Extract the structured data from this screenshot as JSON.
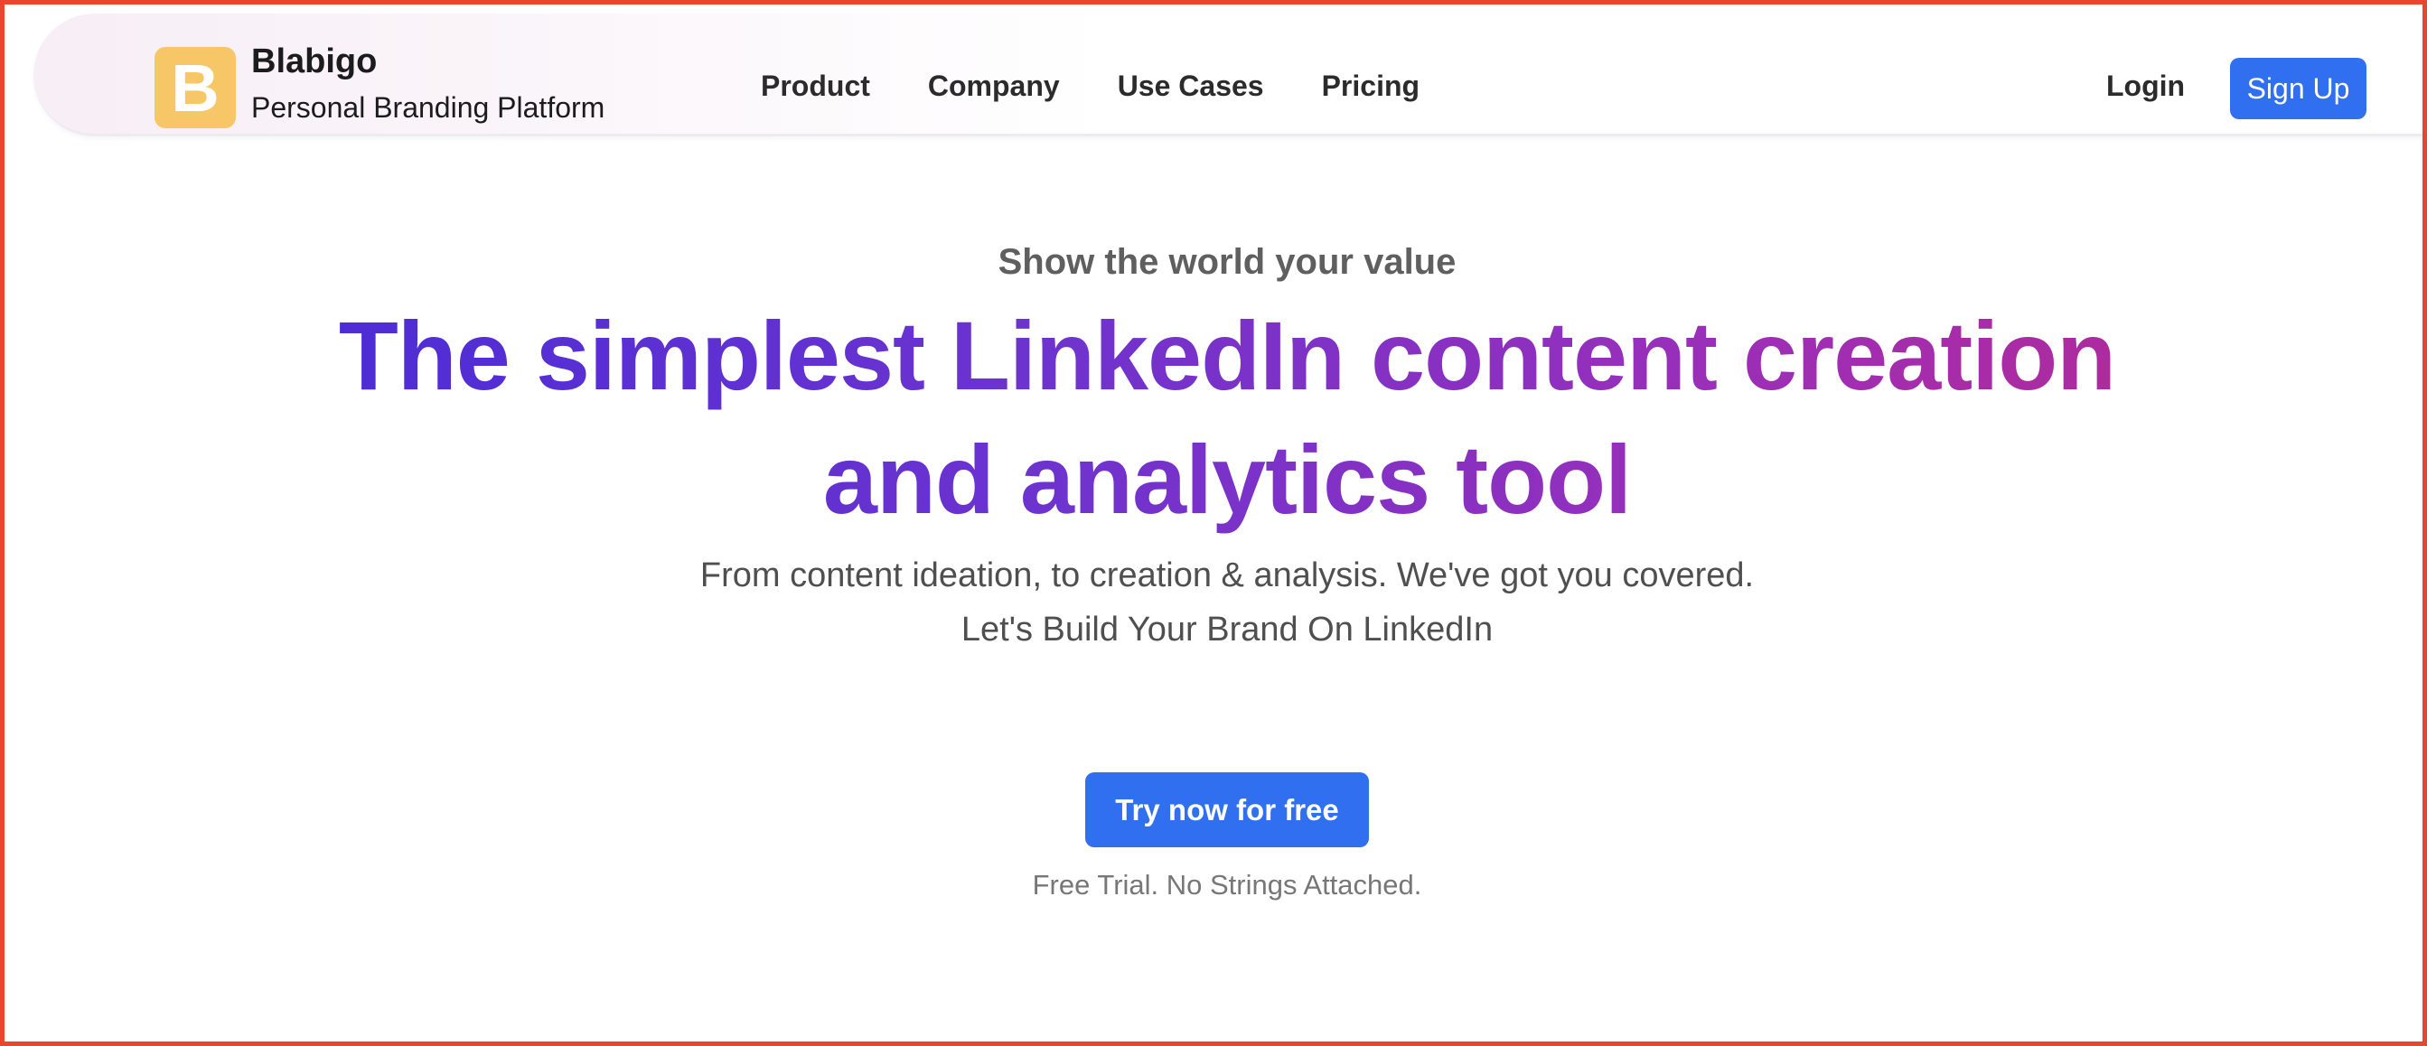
{
  "header": {
    "logo_letter": "B",
    "brand_name": "Blabigo",
    "brand_tagline": "Personal Branding Platform",
    "nav": [
      {
        "label": "Product"
      },
      {
        "label": "Company"
      },
      {
        "label": "Use Cases"
      },
      {
        "label": "Pricing"
      }
    ],
    "login_label": "Login",
    "signup_label": "Sign Up"
  },
  "hero": {
    "eyebrow": "Show the world your value",
    "headline_line1": "The simplest LinkedIn content creation",
    "headline_line2": "and analytics tool",
    "subline1": "From content ideation, to creation & analysis. We've got you covered.",
    "subline2": "Let's Build Your Brand On LinkedIn",
    "cta_label": "Try now for free",
    "cta_note": "Free Trial. No Strings Attached."
  },
  "colors": {
    "accent_blue": "#2f6ff0",
    "logo_yellow": "#f6c667",
    "headline_gradient_start": "#4a2cd6",
    "headline_gradient_end": "#b12a9a",
    "frame_border": "#e8472f"
  }
}
